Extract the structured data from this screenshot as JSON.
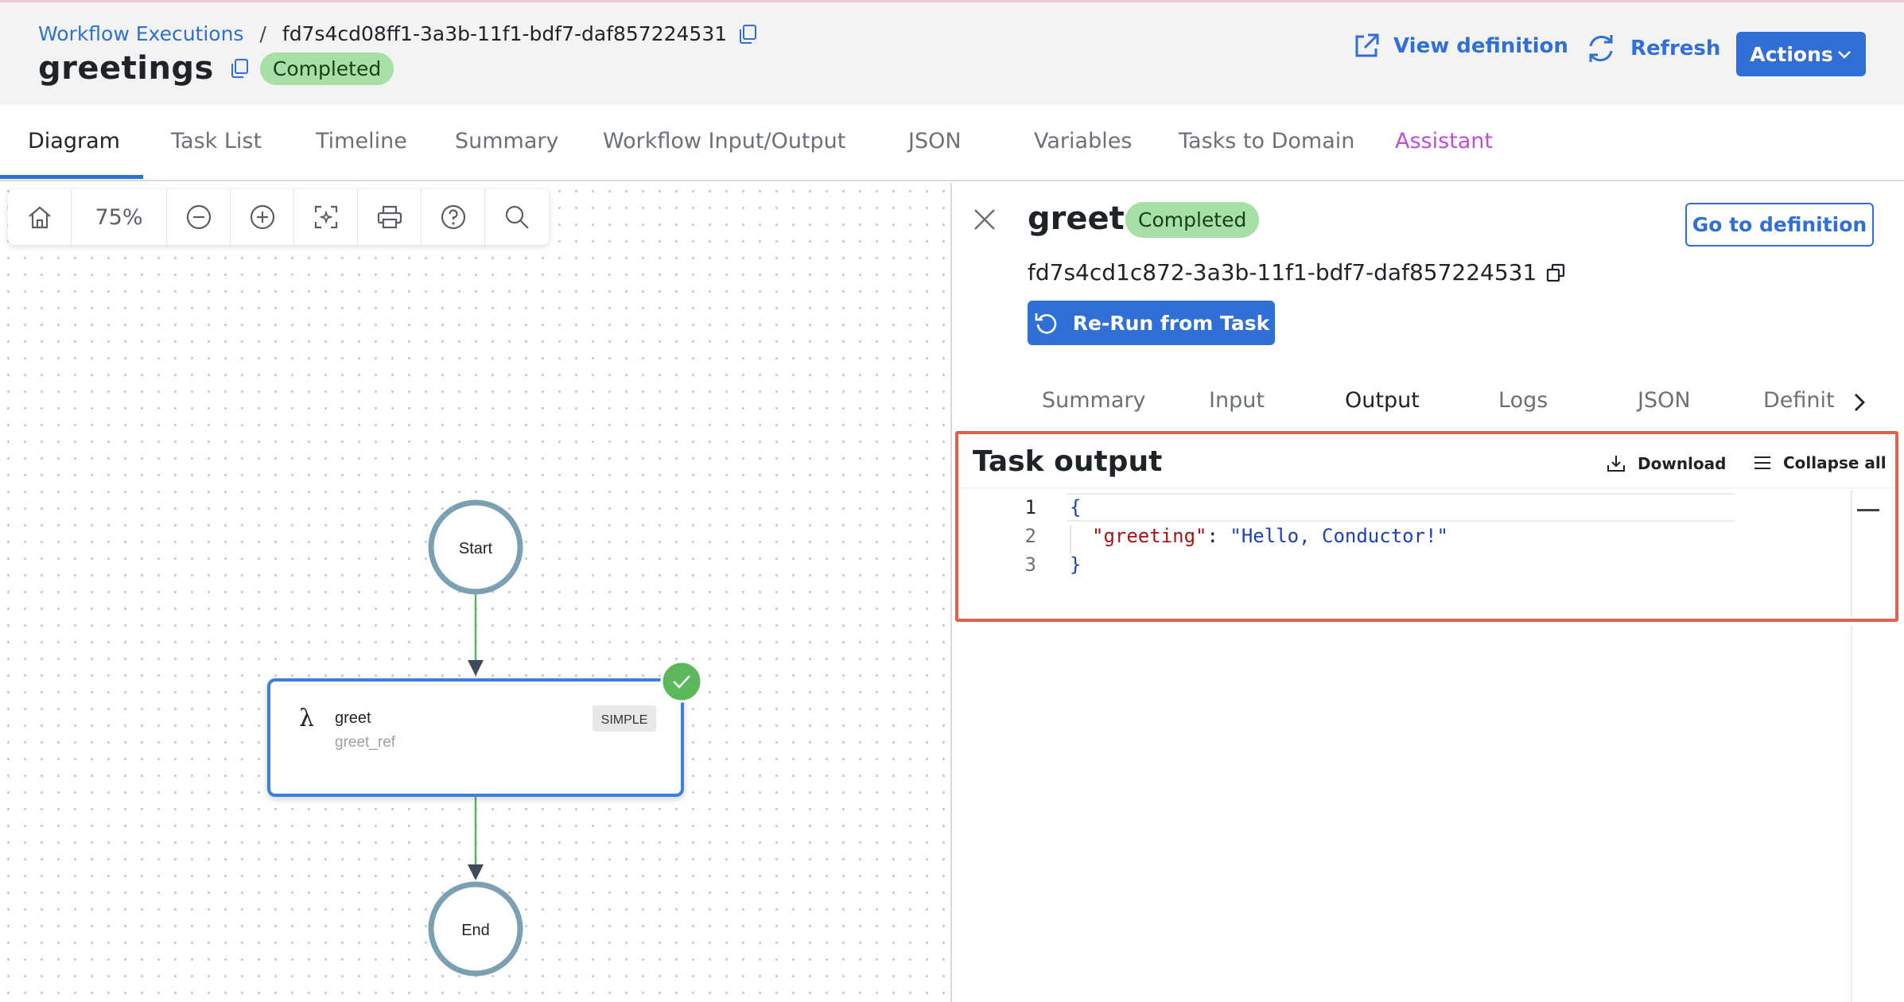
{
  "breadcrumb": {
    "link": "Workflow Executions",
    "separator": "/",
    "execution_id": "fd7s4cd08ff1-3a3b-11f1-bdf7-daf857224531"
  },
  "workflow": {
    "name": "greetings",
    "status": "Completed"
  },
  "header_actions": {
    "view_definition": "View definition",
    "refresh": "Refresh",
    "actions": "Actions"
  },
  "tabs": [
    {
      "label": "Diagram",
      "active": true
    },
    {
      "label": "Task List"
    },
    {
      "label": "Timeline"
    },
    {
      "label": "Summary"
    },
    {
      "label": "Workflow Input/Output"
    },
    {
      "label": "JSON"
    },
    {
      "label": "Variables"
    },
    {
      "label": "Tasks to Domain"
    },
    {
      "label": "Assistant"
    }
  ],
  "toolbar": {
    "zoom": "75%",
    "icons": [
      "home-icon",
      "zoom-out-icon",
      "zoom-in-icon",
      "fit-view-icon",
      "print-icon",
      "help-icon",
      "search-icon"
    ]
  },
  "diagram": {
    "start_label": "Start",
    "end_label": "End",
    "task": {
      "icon": "λ",
      "name": "greet",
      "ref": "greet_ref",
      "type": "SIMPLE",
      "status": "completed"
    }
  },
  "panel": {
    "task_name": "greet",
    "status": "Completed",
    "go_to_definition": "Go to definition",
    "task_id": "fd7s4cd1c872-3a3b-11f1-bdf7-daf857224531",
    "rerun": "Re-Run from Task",
    "tabs": [
      {
        "label": "Summary"
      },
      {
        "label": "Input"
      },
      {
        "label": "Output",
        "active": true
      },
      {
        "label": "Logs"
      },
      {
        "label": "JSON"
      },
      {
        "label": "Definit"
      }
    ],
    "output": {
      "title": "Task output",
      "download": "Download",
      "collapse_all": "Collapse all",
      "lines": [
        {
          "n": "1",
          "open": "{"
        },
        {
          "n": "2",
          "key": "\"greeting\"",
          "colon": ": ",
          "value": "\"Hello, Conductor!\""
        },
        {
          "n": "3",
          "close": "}"
        }
      ]
    }
  },
  "colors": {
    "accent": "#2f6fd6",
    "success_badge": "#a6e0a6",
    "assistant_tab": "#c04ddb",
    "highlight_border": "#e0624e"
  }
}
